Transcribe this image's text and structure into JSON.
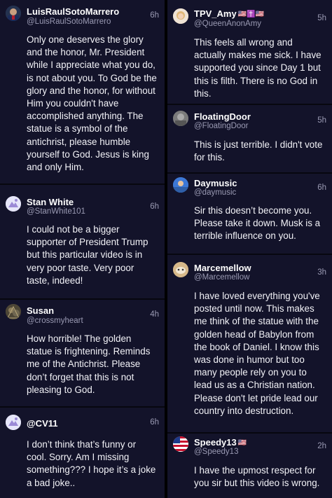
{
  "colors": {
    "background": "#13132a",
    "text": "#f2f2f7",
    "muted": "#9a9ab3",
    "divider": "#000000"
  },
  "left_column": [
    {
      "name": "LuisRaulSotoMarrero",
      "handle": "@LuisRaulSotoMarrero",
      "time": "6h",
      "avatar": "profile-photo",
      "text": "Only one deserves the glory\nand the honor, Mr. President\nwhile I appreciate what you do,\nis not about you. To God be the\nglory and the honor, for without\nHim you couldn't have\naccomplished anything. The\nstatue is a symbol of the\nantichrist, please humble\nyourself to God. Jesus is king\nand only Him."
    },
    {
      "name": "Stan White",
      "handle": "@StanWhite101",
      "time": "6h",
      "avatar": "default-avatar",
      "text": "I could not be a bigger\nsupporter of President Trump\nbut this particular video is in\nvery poor taste. Very poor\ntaste, indeed!"
    },
    {
      "name": "Susan",
      "handle": "@crossmyheart",
      "time": "4h",
      "avatar": "profile-photo",
      "text": "How horrible! The golden\nstatue is frightening. Reminds\nme of the Antichrist. Please\ndon’t forget that this is not\npleasing to God."
    },
    {
      "name": "@CV11",
      "handle": "",
      "time": "6h",
      "avatar": "default-avatar",
      "text": "I don’t think that’s funny or\ncool. Sorry. Am I missing\nsomething??? I hope it’s a joke\na bad joke.."
    }
  ],
  "right_column": [
    {
      "name": "TPV_Amy",
      "name_emoji": "🇺🇸✝️🇺🇸",
      "handle": "@QueenAnonAmy",
      "time": "5h",
      "avatar": "profile-photo",
      "text": "This feels all wrong and\nactually makes me sick. I have\nsupported you since Day 1 but\nthis is filth. There is no God in\nthis."
    },
    {
      "name": "FloatingDoor",
      "handle": "@FloatingDoor",
      "time": "5h",
      "avatar": "profile-photo",
      "text": "This is just terrible. I didn't vote\nfor this."
    },
    {
      "name": "Daymusic",
      "handle": "@daymusic",
      "time": "6h",
      "avatar": "profile-photo",
      "text": "Sir this doesn’t become you.\nPlease take it down. Musk is a\nterrible influence on you."
    },
    {
      "name": "Marcemellow",
      "handle": "@Marcemellow",
      "time": "3h",
      "avatar": "profile-photo",
      "text": "I have loved everything you've\nposted until now. This makes\nme think of the statue with the\ngolden head of Babylon from\nthe book of Daniel. I know this\nwas done in humor but too\nmany people rely on you to\nlead us as a Christian nation.\nPlease don't let pride lead our\ncountry into destruction."
    },
    {
      "name": "Speedy13",
      "name_emoji": "🇺🇸",
      "handle": "@Speedy13",
      "time": "2h",
      "avatar": "profile-photo",
      "text": "I have the upmost respect for\nyou sir but this video is wrong."
    }
  ]
}
